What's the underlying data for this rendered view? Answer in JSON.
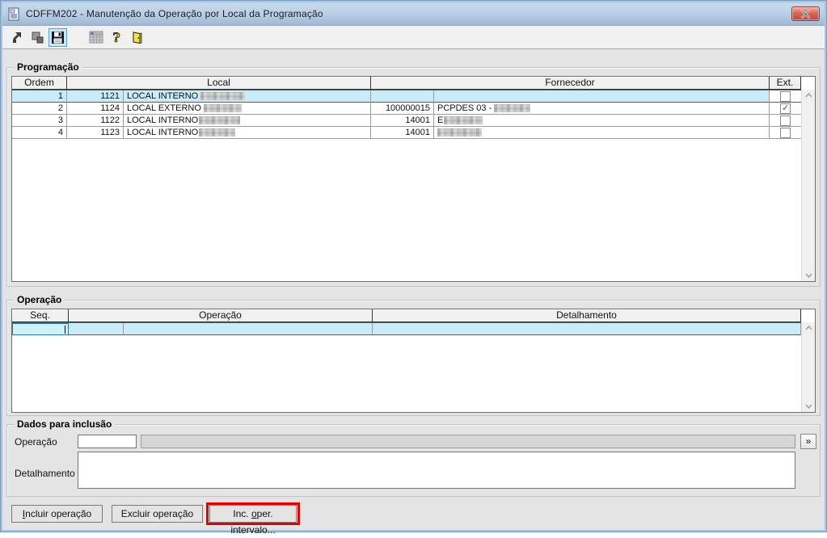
{
  "window": {
    "title": "CDFFM202 - Manutenção da Operação por Local da Programação",
    "title_icon": "document-icon",
    "close_icon": "close-x-icon"
  },
  "toolbar": {
    "icons": [
      {
        "name": "goto-icon",
        "state": "normal"
      },
      {
        "name": "copy-icon",
        "state": "normal"
      },
      {
        "name": "save-icon",
        "state": "selected"
      },
      {
        "name": "calendar-icon",
        "state": "disabled"
      },
      {
        "name": "help-icon",
        "state": "normal"
      },
      {
        "name": "exit-icon",
        "state": "normal"
      }
    ]
  },
  "programacao": {
    "label": "Programação",
    "headers": {
      "ordem": "Ordem",
      "local": "Local",
      "fornecedor": "Fornecedor",
      "ext": "Ext."
    },
    "rows": [
      {
        "ordem": "1",
        "local_code": "1121",
        "local_name": "LOCAL INTERNO",
        "local_redacted": true,
        "forn_code": "",
        "forn_name": "",
        "forn_redacted": false,
        "ext": false,
        "selected": true
      },
      {
        "ordem": "2",
        "local_code": "1124",
        "local_name": "LOCAL EXTERNO",
        "local_redacted": true,
        "forn_code": "100000015",
        "forn_name": "PCPDES 03 -",
        "forn_redacted": true,
        "ext": true,
        "selected": false
      },
      {
        "ordem": "3",
        "local_code": "1122",
        "local_name": "LOCAL INTERNO",
        "local_redacted": true,
        "forn_code": "14001",
        "forn_name": "E",
        "forn_redacted": true,
        "ext": false,
        "selected": false
      },
      {
        "ordem": "4",
        "local_code": "1123",
        "local_name": "LOCAL INTERNO",
        "local_redacted": true,
        "forn_code": "14001",
        "forn_name": "",
        "forn_redacted": true,
        "ext": false,
        "selected": false
      }
    ]
  },
  "operacao": {
    "label": "Operação",
    "headers": {
      "seq": "Seq.",
      "operacao": "Operação",
      "detalhamento": "Detalhamento"
    },
    "row": {
      "seq": "",
      "op_code": "",
      "op_name": "",
      "detalhamento": "",
      "selected": true,
      "focused_cell": "seq"
    }
  },
  "dados": {
    "label": "Dados para inclusão",
    "operacao_label": "Operação",
    "operacao_value": "",
    "operacao_desc_value": "",
    "detalhamento_label": "Detalhamento",
    "detalhamento_value": "",
    "expand_button": "»"
  },
  "buttons": {
    "incluir": {
      "pre": "",
      "mnemonic": "I",
      "post": "ncluir operação"
    },
    "excluir": {
      "label": "Excluir operação"
    },
    "intervalo": {
      "pre": "Inc. ",
      "mnemonic": "o",
      "post": "per. intervalo..."
    }
  },
  "colors": {
    "titlebar": "#bed3e8",
    "selection_row": "#c9ecfa",
    "focus_border": "#2a72b5",
    "annotation_red": "#e80000",
    "close_button_red": "#c14438",
    "toolbar_selected_bg": "#cbe6f7"
  }
}
